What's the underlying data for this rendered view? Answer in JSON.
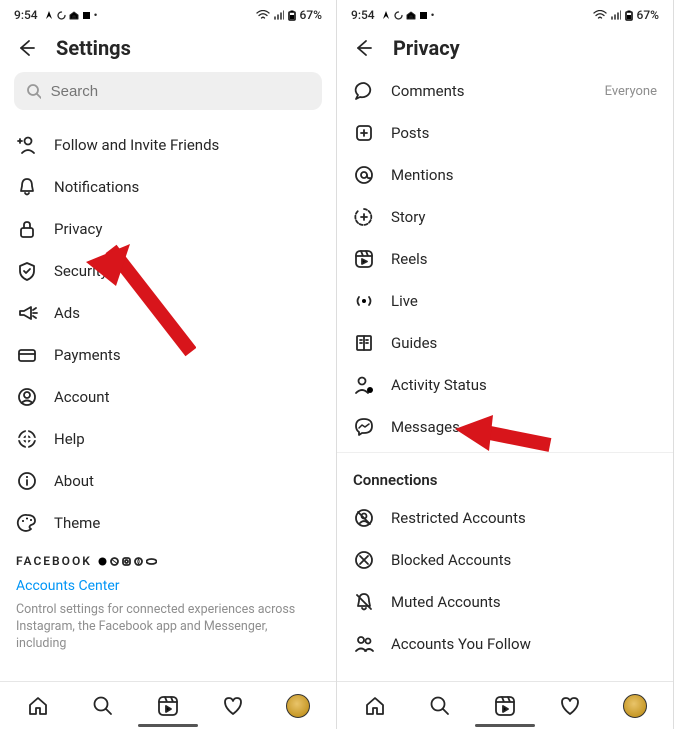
{
  "status": {
    "time": "9:54",
    "battery": "67%"
  },
  "left": {
    "title": "Settings",
    "search_placeholder": "Search",
    "items": [
      {
        "label": "Follow and Invite Friends"
      },
      {
        "label": "Notifications"
      },
      {
        "label": "Privacy"
      },
      {
        "label": "Security"
      },
      {
        "label": "Ads"
      },
      {
        "label": "Payments"
      },
      {
        "label": "Account"
      },
      {
        "label": "Help"
      },
      {
        "label": "About"
      },
      {
        "label": "Theme"
      }
    ],
    "fb_wordmark": "FACEBOOK",
    "accounts_center": "Accounts Center",
    "fb_desc": "Control settings for connected experiences across Instagram, the Facebook app and Messenger, including"
  },
  "right": {
    "title": "Privacy",
    "items": [
      {
        "label": "Comments",
        "meta": "Everyone"
      },
      {
        "label": "Posts"
      },
      {
        "label": "Mentions"
      },
      {
        "label": "Story"
      },
      {
        "label": "Reels"
      },
      {
        "label": "Live"
      },
      {
        "label": "Guides"
      },
      {
        "label": "Activity Status"
      },
      {
        "label": "Messages"
      }
    ],
    "connections_title": "Connections",
    "connections": [
      {
        "label": "Restricted Accounts"
      },
      {
        "label": "Blocked Accounts"
      },
      {
        "label": "Muted Accounts"
      },
      {
        "label": "Accounts You Follow"
      }
    ]
  }
}
